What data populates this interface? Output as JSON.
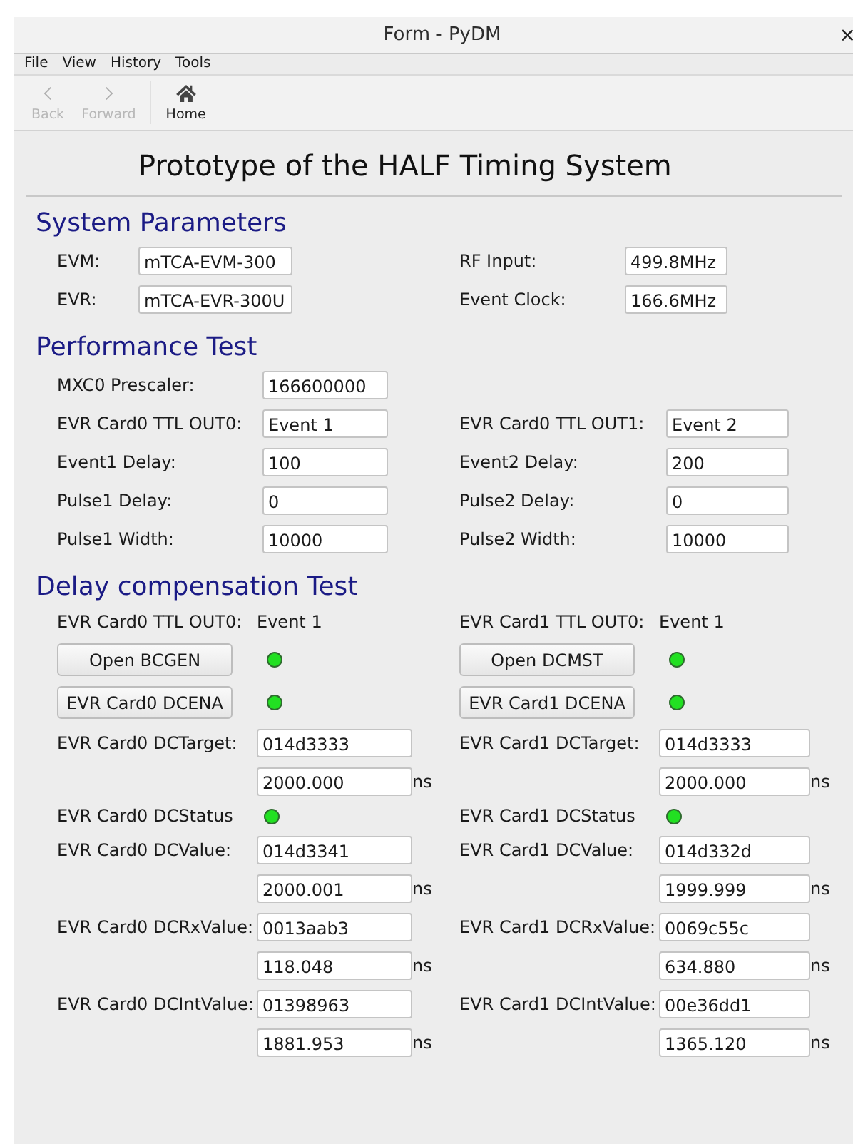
{
  "window": {
    "title": "Form - PyDM",
    "close": "×"
  },
  "menu": [
    "File",
    "View",
    "History",
    "Tools"
  ],
  "toolbar": [
    {
      "label": "Back",
      "disabled": true
    },
    {
      "label": "Forward",
      "disabled": true
    },
    {
      "label": "Home",
      "disabled": false
    }
  ],
  "heading": "Prototype of the HALF Timing System",
  "sections": [
    {
      "title": "System Parameters",
      "rows": [
        [
          {
            "kind": "field",
            "label": "EVM:",
            "value": "mTCA-EVM-300"
          },
          {
            "kind": "field",
            "label": "RF Input:",
            "value": "499.8MHz"
          }
        ],
        [
          {
            "kind": "field",
            "label": "EVR:",
            "value": "mTCA-EVR-300U"
          },
          {
            "kind": "field",
            "label": "Event Clock:",
            "value": "166.6MHz"
          }
        ]
      ]
    },
    {
      "title": "Performance Test",
      "rows": [
        [
          {
            "kind": "field",
            "label": "MXC0 Prescaler:",
            "value": "166600000"
          }
        ],
        [
          {
            "kind": "field",
            "label": "EVR Card0 TTL OUT0:",
            "value": "Event 1"
          },
          {
            "kind": "field",
            "label": "EVR Card0 TTL OUT1:",
            "value": "Event 2"
          }
        ],
        [
          {
            "kind": "field",
            "label": "Event1 Delay:",
            "value": "100"
          },
          {
            "kind": "field",
            "label": "Event2 Delay:",
            "value": "200"
          }
        ],
        [
          {
            "kind": "field",
            "label": "Pulse1 Delay:",
            "value": "0"
          },
          {
            "kind": "field",
            "label": "Pulse2 Delay:",
            "value": "0"
          }
        ],
        [
          {
            "kind": "field",
            "label": "Pulse1 Width:",
            "value": "10000"
          },
          {
            "kind": "field",
            "label": "Pulse2 Width:",
            "value": "10000"
          }
        ]
      ]
    },
    {
      "title": "Delay compensation Test",
      "rows": [
        [
          {
            "kind": "text",
            "label": "EVR Card0 TTL OUT0:",
            "value": "Event 1"
          },
          {
            "kind": "text",
            "label": "EVR Card1 TTL OUT0:",
            "value": "Event 1"
          }
        ],
        [
          {
            "kind": "button",
            "label": "Open BCGEN",
            "on": true
          },
          {
            "kind": "button",
            "label": "Open DCMST",
            "on": true
          }
        ],
        [
          {
            "kind": "button",
            "label": "EVR Card0 DCENA",
            "on": true
          },
          {
            "kind": "button",
            "label": "EVR Card1 DCENA",
            "on": true
          }
        ],
        [
          {
            "kind": "field",
            "label": "EVR Card0 DCTarget:",
            "value": "014d3333"
          },
          {
            "kind": "field",
            "label": "EVR Card1 DCTarget:",
            "value": "014d3333"
          }
        ],
        [
          {
            "kind": "unit",
            "value": "2000.000",
            "unit": "ns"
          },
          {
            "kind": "unit",
            "value": "2000.000",
            "unit": "ns"
          }
        ],
        [
          {
            "kind": "led",
            "label": "EVR Card0 DCStatus",
            "on": true
          },
          {
            "kind": "led",
            "label": "EVR Card1 DCStatus",
            "on": true
          }
        ],
        [
          {
            "kind": "field",
            "label": "EVR Card0 DCValue:",
            "value": "014d3341"
          },
          {
            "kind": "field",
            "label": "EVR Card1 DCValue:",
            "value": "014d332d"
          }
        ],
        [
          {
            "kind": "unit",
            "value": "2000.001",
            "unit": "ns"
          },
          {
            "kind": "unit",
            "value": "1999.999",
            "unit": "ns"
          }
        ],
        [
          {
            "kind": "field",
            "label": "EVR Card0 DCRxValue:",
            "value": "0013aab3"
          },
          {
            "kind": "field",
            "label": "EVR Card1 DCRxValue:",
            "value": "0069c55c"
          }
        ],
        [
          {
            "kind": "unit",
            "value": "118.048",
            "unit": "ns"
          },
          {
            "kind": "unit",
            "value": "634.880",
            "unit": "ns"
          }
        ],
        [
          {
            "kind": "field",
            "label": "EVR Card0 DCIntValue:",
            "value": "01398963"
          },
          {
            "kind": "field",
            "label": "EVR Card1 DCIntValue:",
            "value": "00e36dd1"
          }
        ],
        [
          {
            "kind": "unit",
            "value": "1881.953",
            "unit": "ns"
          },
          {
            "kind": "unit",
            "value": "1365.120",
            "unit": "ns"
          }
        ]
      ]
    }
  ]
}
